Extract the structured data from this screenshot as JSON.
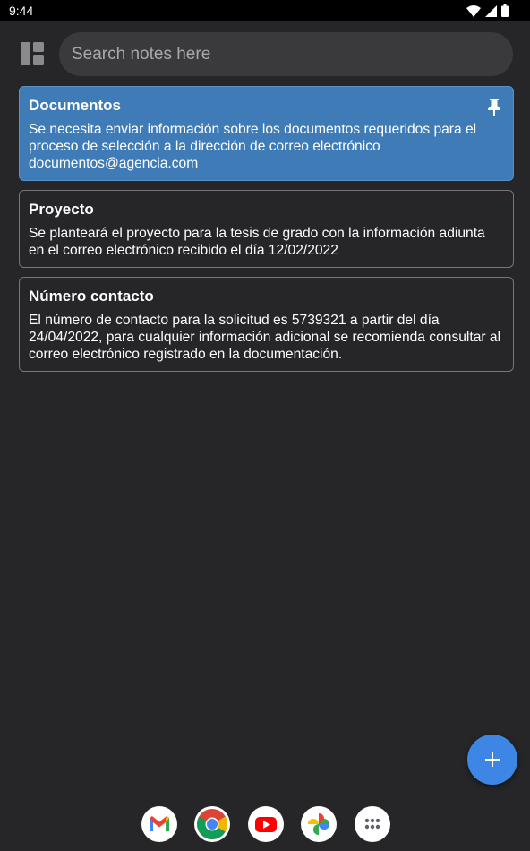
{
  "status_bar": {
    "time": "9:44"
  },
  "search": {
    "placeholder": "Search notes here"
  },
  "notes": [
    {
      "title": "Documentos",
      "body": "Se necesita enviar información sobre los documentos requeridos para el proceso de selección a la dirección de correo electrónico documentos@agencia.com",
      "pinned": true
    },
    {
      "title": "Proyecto",
      "body": "Se planteará el proyecto para la tesis de grado con la información adiunta en el correo electrónico recibido el día 12/02/2022",
      "pinned": false
    },
    {
      "title": "Número contacto",
      "body": "El número de contacto para la solicitud es 5739321 a partir del día 24/04/2022, para cualquier información adicional se recomienda consultar al correo electrónico registrado en la documentación.",
      "pinned": false
    }
  ],
  "dock": [
    "gmail-icon",
    "chrome-icon",
    "youtube-icon",
    "photos-icon",
    "app-drawer-icon"
  ],
  "colors": {
    "background": "#262628",
    "pinned_note": "#3f7cb7",
    "fab": "#3d86e6",
    "search_bg": "#3a3a3c"
  }
}
